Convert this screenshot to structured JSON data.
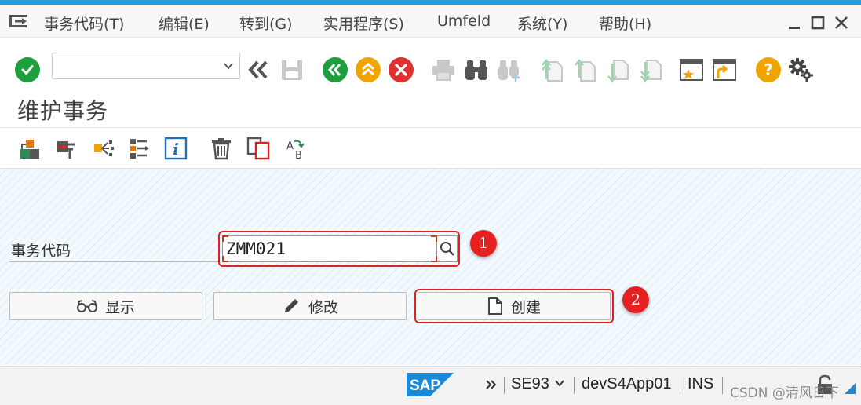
{
  "menu": {
    "items": [
      {
        "label": "事务代码(T)"
      },
      {
        "label": "编辑(E)"
      },
      {
        "label": "转到(G)"
      },
      {
        "label": "实用程序(S)"
      },
      {
        "label": "Umfeld"
      },
      {
        "label": "系统(Y)"
      },
      {
        "label": "帮助(H)"
      }
    ]
  },
  "toolbar": {
    "command_field_value": "",
    "icons": [
      "enter-icon",
      "back-icon",
      "exit-icon",
      "cancel-icon",
      "print-icon",
      "find-icon",
      "find-next-icon",
      "first-page-icon",
      "previous-page-icon",
      "next-page-icon",
      "last-page-icon",
      "new-session-icon",
      "create-shortcut-icon",
      "help-icon",
      "customize-layout-icon"
    ]
  },
  "title": "维护事务",
  "app_toolbar": {
    "icons": [
      "other-object-icon",
      "where-used-icon",
      "check-icon",
      "object-list-icon",
      "information-icon",
      "delete-icon",
      "copy-icon",
      "translation-icon"
    ]
  },
  "form": {
    "label": "事务代码",
    "value": "ZMM021"
  },
  "buttons": {
    "display": "显示",
    "change": "修改",
    "create": "创建"
  },
  "annotations": {
    "badge1": "1",
    "badge2": "2",
    "color": "#e02020"
  },
  "status": {
    "transaction": "SE93",
    "server": "devS4App01",
    "mode": "INS",
    "brand": "SAP",
    "watermark": "CSDN @清风日下"
  },
  "colors": {
    "accent": "#1f9fe0",
    "ok_green": "#1e9e3d",
    "exit_orange": "#f0a400",
    "cancel_red": "#e03030",
    "sap_blue": "#1c8ad6"
  }
}
